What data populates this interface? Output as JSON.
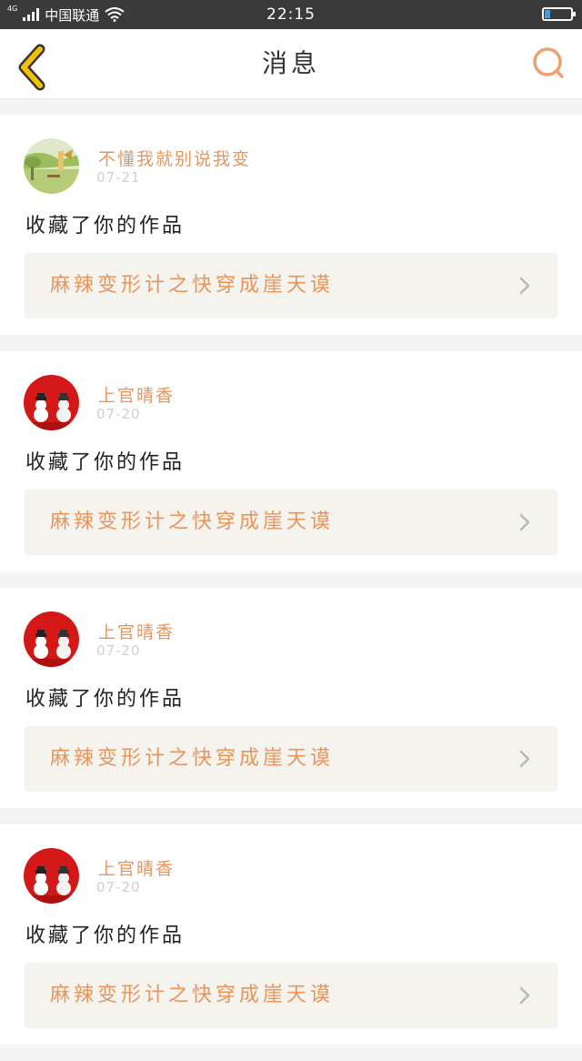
{
  "status_bar": {
    "network": "4G",
    "carrier": "中国联通",
    "time": "22:15",
    "battery_level": 0.2
  },
  "header": {
    "title": "消息"
  },
  "colors": {
    "accent": "#e8955c",
    "back_icon": "#f2c200",
    "link_bg": "#f4f3ee"
  },
  "messages": [
    {
      "username": "不懂我就别说我变",
      "date": "07-21",
      "action": "收藏了你的作品",
      "work_title": "麻辣变形计之快穿成崖天谟",
      "avatar": "avatar-nature"
    },
    {
      "username": "上官晴香",
      "date": "07-20",
      "action": "收藏了你的作品",
      "work_title": "麻辣变形计之快穿成崖天谟",
      "avatar": "avatar-snowman"
    },
    {
      "username": "上官晴香",
      "date": "07-20",
      "action": "收藏了你的作品",
      "work_title": "麻辣变形计之快穿成崖天谟",
      "avatar": "avatar-snowman"
    },
    {
      "username": "上官晴香",
      "date": "07-20",
      "action": "收藏了你的作品",
      "work_title": "麻辣变形计之快穿成崖天谟",
      "avatar": "avatar-snowman"
    }
  ]
}
